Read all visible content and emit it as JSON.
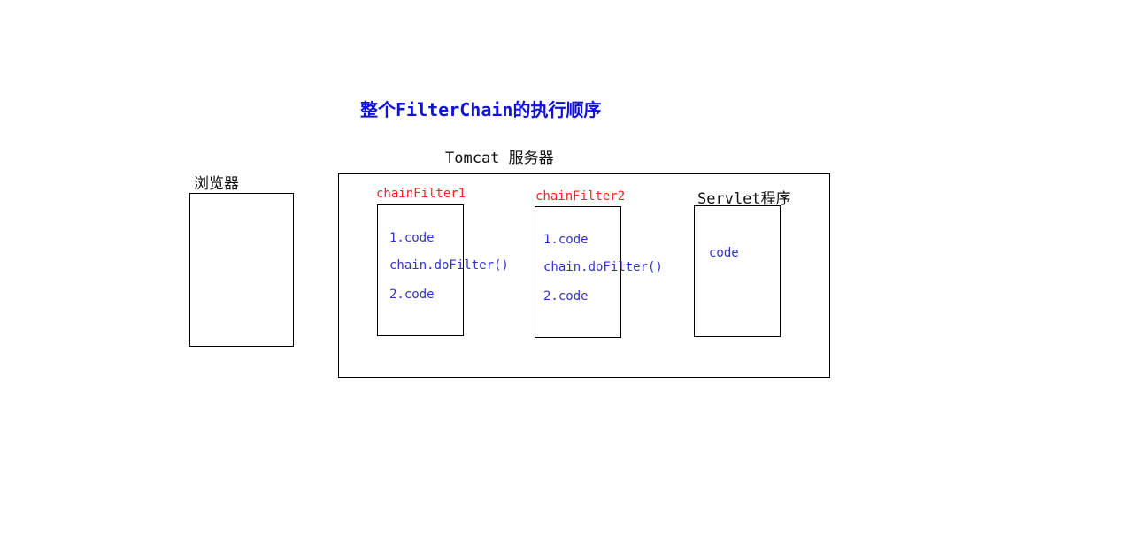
{
  "title": "整个FilterChain的执行顺序",
  "tomcat_label": "Tomcat 服务器",
  "browser_label": "浏览器",
  "filter1": {
    "label": "chainFilter1",
    "line1": "1.code",
    "line2": "chain.doFilter()",
    "line3": "2.code"
  },
  "filter2": {
    "label": "chainFilter2",
    "line1": "1.code",
    "line2": "chain.doFilter()",
    "line3": "2.code"
  },
  "servlet": {
    "label": "Servlet程序",
    "line1": "code"
  }
}
